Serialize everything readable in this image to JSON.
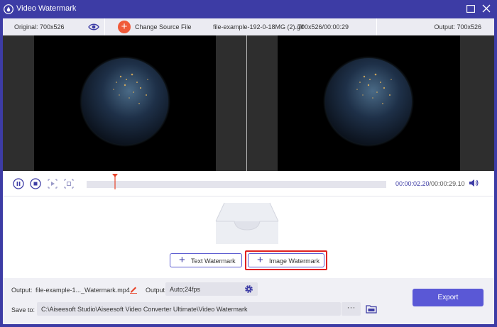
{
  "window": {
    "title": "Video Watermark"
  },
  "infobar": {
    "original": "Original: 700x526",
    "change_source": "Change Source File",
    "filename": "file-example-192-0-18MG (2).gif",
    "fileinfo": "700x526/00:00:29",
    "output": "Output: 700x526"
  },
  "player": {
    "current_time": "00:00:02.20",
    "total_time": "/00:00:29.10",
    "progress": 0.07
  },
  "watermark": {
    "text_label": "Text Watermark",
    "image_label": "Image Watermark"
  },
  "bottom": {
    "output_label": "Output:",
    "output_file": "file-example-1..._Watermark.mp4",
    "output2_label": "Output:",
    "format_value": "Auto;24fps",
    "save_label": "Save to:",
    "save_path": "C:\\Aiseesoft Studio\\Aiseesoft Video Converter Ultimate\\Video Watermark",
    "browse_label": "···",
    "export_label": "Export"
  },
  "colors": {
    "brand": "#3d3ca5",
    "accent": "#5a58d6",
    "change_source": "#f05a3a",
    "highlight": "#e02020"
  },
  "icons": [
    "app-logo-icon",
    "maximize-icon",
    "close-icon",
    "eye-icon",
    "plus-icon",
    "pause-icon",
    "stop-icon",
    "play-clip-icon",
    "crop-icon",
    "volume-icon",
    "edit-icon",
    "gear-icon",
    "folder-icon",
    "tray-icon"
  ]
}
